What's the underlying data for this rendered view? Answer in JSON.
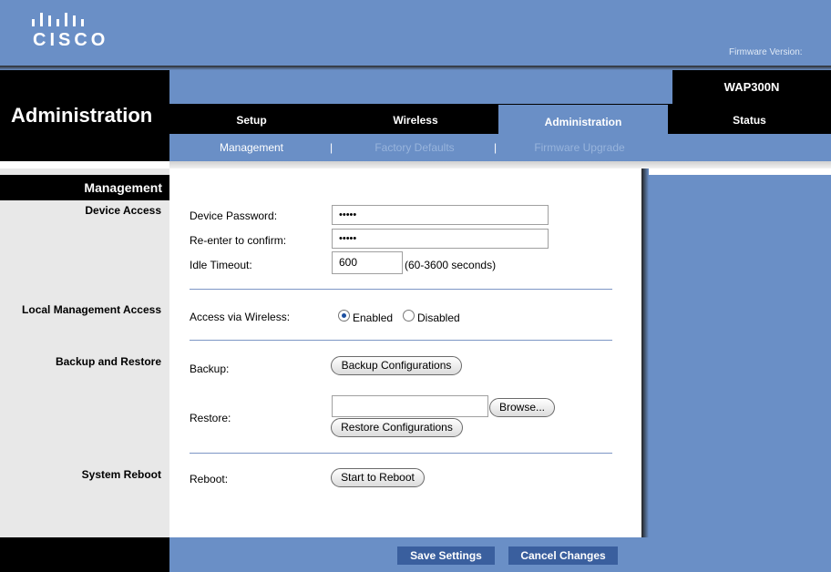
{
  "header": {
    "logo_text": "CISCO",
    "firmware_label": "Firmware Version:",
    "model": "WAP300N",
    "page_heading": "Administration"
  },
  "main_tabs": [
    {
      "label": "Setup"
    },
    {
      "label": "Wireless"
    },
    {
      "label": "Administration",
      "active": true
    },
    {
      "label": "Status"
    }
  ],
  "sub_tabs": [
    {
      "label": "Management",
      "active": true
    },
    {
      "label": "Factory Defaults"
    },
    {
      "label": "Firmware Upgrade"
    }
  ],
  "sidebar": {
    "section_title": "Management",
    "groups": [
      "Device Access",
      "Local Management Access",
      "Backup and Restore",
      "System Reboot"
    ]
  },
  "device_access": {
    "password_label": "Device Password:",
    "password_value": "•••••",
    "confirm_label": "Re-enter to confirm:",
    "confirm_value": "•••••",
    "timeout_label": "Idle Timeout:",
    "timeout_value": "600",
    "timeout_hint": "(60-3600 seconds)"
  },
  "local_access": {
    "wireless_label": "Access via Wireless:",
    "enabled_label": "Enabled",
    "disabled_label": "Disabled",
    "selected": "Enabled"
  },
  "backup": {
    "backup_label": "Backup:",
    "backup_button": "Backup Configurations",
    "restore_label": "Restore:",
    "browse_button": "Browse...",
    "restore_button": "Restore Configurations"
  },
  "reboot": {
    "reboot_label": "Reboot:",
    "reboot_button": "Start to Reboot"
  },
  "footer": {
    "save": "Save Settings",
    "cancel": "Cancel Changes"
  },
  "colors": {
    "brand_blue": "#6a8fc6",
    "footer_button": "#3a5f9e",
    "band": "#000000"
  },
  "icons": [
    "cisco-logo-icon",
    "radio-selected-icon",
    "radio-unselected-icon"
  ]
}
